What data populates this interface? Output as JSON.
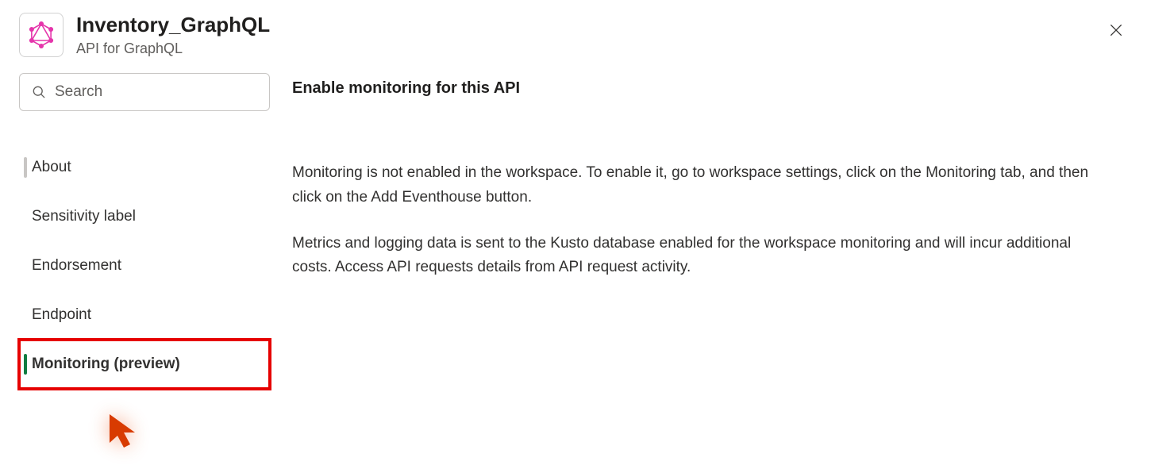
{
  "header": {
    "title": "Inventory_GraphQL",
    "subtitle": "API for GraphQL",
    "icon": "graphql-icon"
  },
  "search": {
    "placeholder": "Search"
  },
  "sidebar": {
    "items": [
      {
        "label": "About",
        "key": "about"
      },
      {
        "label": "Sensitivity label",
        "key": "sensitivity"
      },
      {
        "label": "Endorsement",
        "key": "endorsement"
      },
      {
        "label": "Endpoint",
        "key": "endpoint"
      },
      {
        "label": "Monitoring (preview)",
        "key": "monitoring"
      }
    ],
    "active_key": "monitoring",
    "highlighted_key": "monitoring"
  },
  "content": {
    "heading": "Enable monitoring for this API",
    "paragraph1": "Monitoring is not enabled in the workspace. To enable it, go to workspace settings, click on the Monitoring tab, and then click on the Add Eventhouse button.",
    "paragraph2": "Metrics and logging data is sent to the Kusto database enabled for the workspace monitoring and will incur additional costs. Access API requests details from API request activity."
  }
}
